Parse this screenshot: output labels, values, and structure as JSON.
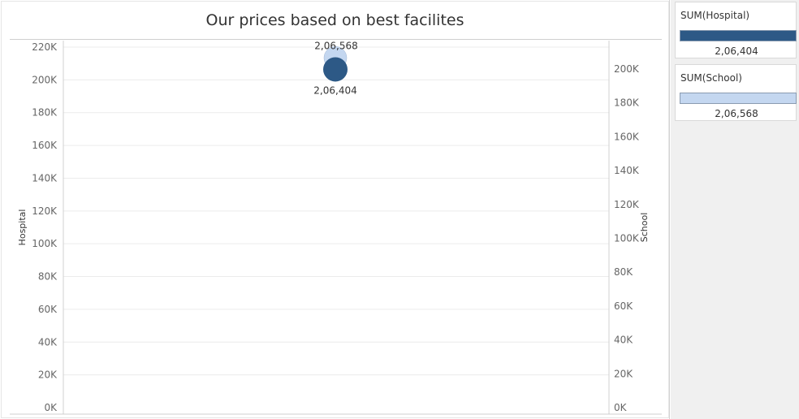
{
  "chart_data": {
    "type": "scatter",
    "title": "Our prices based on best facilites",
    "left_axis": {
      "label": "Hospital",
      "range": [
        0,
        220000
      ],
      "ticks": [
        0,
        20000,
        40000,
        60000,
        80000,
        100000,
        120000,
        140000,
        160000,
        180000,
        200000,
        220000
      ],
      "tick_labels": [
        "0K",
        "20K",
        "40K",
        "60K",
        "80K",
        "100K",
        "120K",
        "140K",
        "160K",
        "180K",
        "200K",
        "220K"
      ]
    },
    "right_axis": {
      "label": "School",
      "range": [
        0,
        210000
      ],
      "ticks": [
        0,
        20000,
        40000,
        60000,
        80000,
        100000,
        120000,
        140000,
        160000,
        180000,
        200000
      ],
      "tick_labels": [
        "0K",
        "20K",
        "40K",
        "60K",
        "80K",
        "100K",
        "120K",
        "140K",
        "160K",
        "180K",
        "200K"
      ]
    },
    "series": [
      {
        "name": "SUM(Hospital)",
        "axis": "left",
        "value": 206404,
        "label": "2,06,404",
        "color": "#2d5986"
      },
      {
        "name": "SUM(School)",
        "axis": "right",
        "value": 206568,
        "label": "2,06,568",
        "color": "#c4d7f0"
      }
    ],
    "grid": true
  },
  "legend": [
    {
      "title": "SUM(Hospital)",
      "value": "2,06,404",
      "color": "#2d5986"
    },
    {
      "title": "SUM(School)",
      "value": "2,06,568",
      "color": "#c4d7f0"
    }
  ]
}
